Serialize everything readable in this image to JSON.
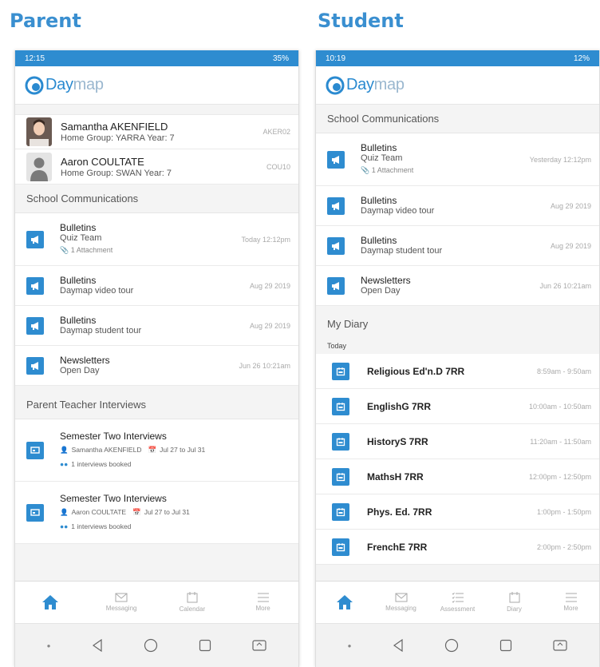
{
  "titles": {
    "parent": "Parent",
    "student": "Student"
  },
  "colors": {
    "accent": "#2e8cd0",
    "heading": "#3a8fd0"
  },
  "parent": {
    "status": {
      "time": "12:15",
      "battery": "35%"
    },
    "app_name_day": "Day",
    "app_name_map": "map",
    "children": [
      {
        "name": "Samantha AKENFIELD",
        "sub": "Home Group: YARRA Year: 7",
        "code": "AKER02"
      },
      {
        "name": "Aaron COULTATE",
        "sub": "Home Group: SWAN Year: 7",
        "code": "COU10"
      }
    ],
    "comms_header": "School Communications",
    "comms": [
      {
        "title": "Bulletins",
        "sub": "Quiz Team",
        "attach": "1 Attachment",
        "date": "Today 12:12pm"
      },
      {
        "title": "Bulletins",
        "sub": "Daymap video tour",
        "date": "Aug 29 2019"
      },
      {
        "title": "Bulletins",
        "sub": "Daymap student tour",
        "date": "Aug 29 2019"
      },
      {
        "title": "Newsletters",
        "sub": "Open Day",
        "date": "Jun 26 10:21am"
      }
    ],
    "ptI_header": "Parent Teacher Interviews",
    "interviews": [
      {
        "title": "Semester Two Interviews",
        "person": "Samantha AKENFIELD",
        "dates": "Jul 27 to Jul 31",
        "booked": "1 interviews booked"
      },
      {
        "title": "Semester Two Interviews",
        "person": "Aaron COULTATE",
        "dates": "Jul 27 to Jul 31",
        "booked": "1 interviews booked"
      }
    ],
    "nav": [
      {
        "label": "",
        "icon": "home-icon",
        "active": true
      },
      {
        "label": "Messaging",
        "icon": "envelope-icon"
      },
      {
        "label": "Calendar",
        "icon": "calendar-icon"
      },
      {
        "label": "More",
        "icon": "menu-icon"
      }
    ]
  },
  "student": {
    "status": {
      "time": "10:19",
      "battery": "12%"
    },
    "app_name_day": "Day",
    "app_name_map": "map",
    "comms_header": "School Communications",
    "comms": [
      {
        "title": "Bulletins",
        "sub": "Quiz Team",
        "attach": "1 Attachment",
        "date": "Yesterday 12:12pm"
      },
      {
        "title": "Bulletins",
        "sub": "Daymap video tour",
        "date": "Aug 29 2019"
      },
      {
        "title": "Bulletins",
        "sub": "Daymap student tour",
        "date": "Aug 29 2019"
      },
      {
        "title": "Newsletters",
        "sub": "Open Day",
        "date": "Jun 26 10:21am"
      }
    ],
    "diary_header": "My Diary",
    "diary_day": "Today",
    "diary": [
      {
        "title": "Religious Ed'n.D 7RR",
        "time": "8:59am - 9:50am"
      },
      {
        "title": "EnglishG 7RR",
        "time": "10:00am - 10:50am"
      },
      {
        "title": "HistoryS 7RR",
        "time": "11:20am - 11:50am"
      },
      {
        "title": "MathsH 7RR",
        "time": "12:00pm - 12:50pm"
      },
      {
        "title": "Phys. Ed. 7RR",
        "time": "1:00pm - 1:50pm"
      },
      {
        "title": "FrenchE 7RR",
        "time": "2:00pm - 2:50pm"
      }
    ],
    "nav": [
      {
        "label": "",
        "icon": "home-icon",
        "active": true
      },
      {
        "label": "Messaging",
        "icon": "envelope-icon"
      },
      {
        "label": "Assessment",
        "icon": "checklist-icon"
      },
      {
        "label": "Diary",
        "icon": "calendar-icon"
      },
      {
        "label": "More",
        "icon": "menu-icon"
      }
    ]
  }
}
